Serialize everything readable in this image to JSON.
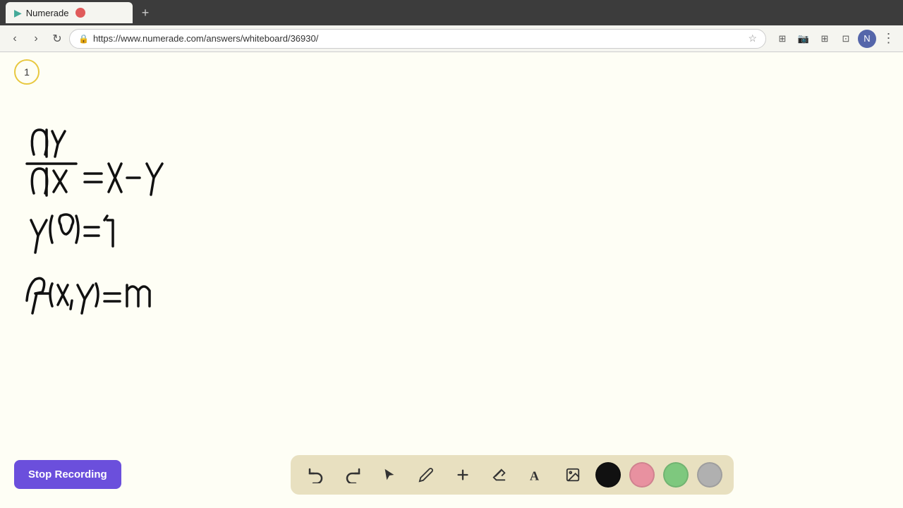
{
  "browser": {
    "tab_title": "Numerade",
    "tab_close_label": "×",
    "tab_new_label": "+",
    "url": "https://www.numerade.com/answers/whiteboard/36930/",
    "nav_back": "‹",
    "nav_forward": "›",
    "nav_refresh": "↻"
  },
  "page_indicator": "1",
  "stop_recording_btn": "Stop Recording",
  "toolbar": {
    "undo_label": "↩",
    "redo_label": "↪",
    "select_label": "▶",
    "pencil_label": "✏",
    "plus_label": "+",
    "eraser_label": "/",
    "text_label": "A",
    "image_label": "🖼",
    "colors": [
      "black",
      "pink",
      "green",
      "gray"
    ]
  }
}
